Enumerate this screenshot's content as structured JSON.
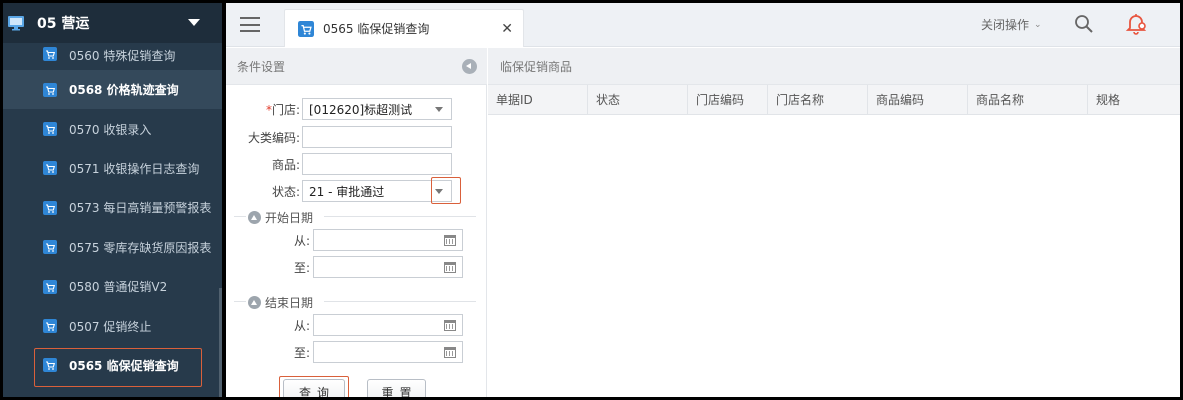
{
  "sidebar": {
    "group_title": "05 营运",
    "items": [
      {
        "label": "0560 特殊促销查询"
      },
      {
        "label": "0568 价格轨迹查询"
      },
      {
        "label": "0570 收银录入"
      },
      {
        "label": "0571 收银操作日志查询"
      },
      {
        "label": "0573 每日高销量预警报表"
      },
      {
        "label": "0575 零库存缺货原因报表"
      },
      {
        "label": "0580 普通促销V2"
      },
      {
        "label": "0507 促销终止"
      },
      {
        "label": "0565 临保促销查询"
      }
    ]
  },
  "topbar": {
    "tab_label": "0565 临保促销查询",
    "tab_close": "✕",
    "close_ops_label": "关闭操作",
    "close_ops_chevron": "⌄"
  },
  "left_panel": {
    "title": "条件设置",
    "store_label": "*门店:",
    "store_value": "[012620]标超测试",
    "category_label": "大类编码:",
    "category_value": "",
    "product_label": "商品:",
    "product_value": "",
    "status_label": "状态:",
    "status_value": "21 - 审批通过",
    "start_date": {
      "legend": "开始日期",
      "from_label": "从:",
      "to_label": "至:",
      "from_value": "",
      "to_value": ""
    },
    "end_date": {
      "legend": "结束日期",
      "from_label": "从:",
      "to_label": "至:",
      "from_value": "",
      "to_value": ""
    },
    "query_button": "查询",
    "reset_button": "重置"
  },
  "right_panel": {
    "title": "临保促销商品",
    "columns": [
      "单据ID",
      "状态",
      "门店编码",
      "门店名称",
      "商品编码",
      "商品名称",
      "规格"
    ],
    "rows": []
  },
  "colors": {
    "sidebar_bg": "#273a4b",
    "highlight": "#d9603b",
    "bell": "#e8553f",
    "cart_icon": "#3a8ee6"
  }
}
